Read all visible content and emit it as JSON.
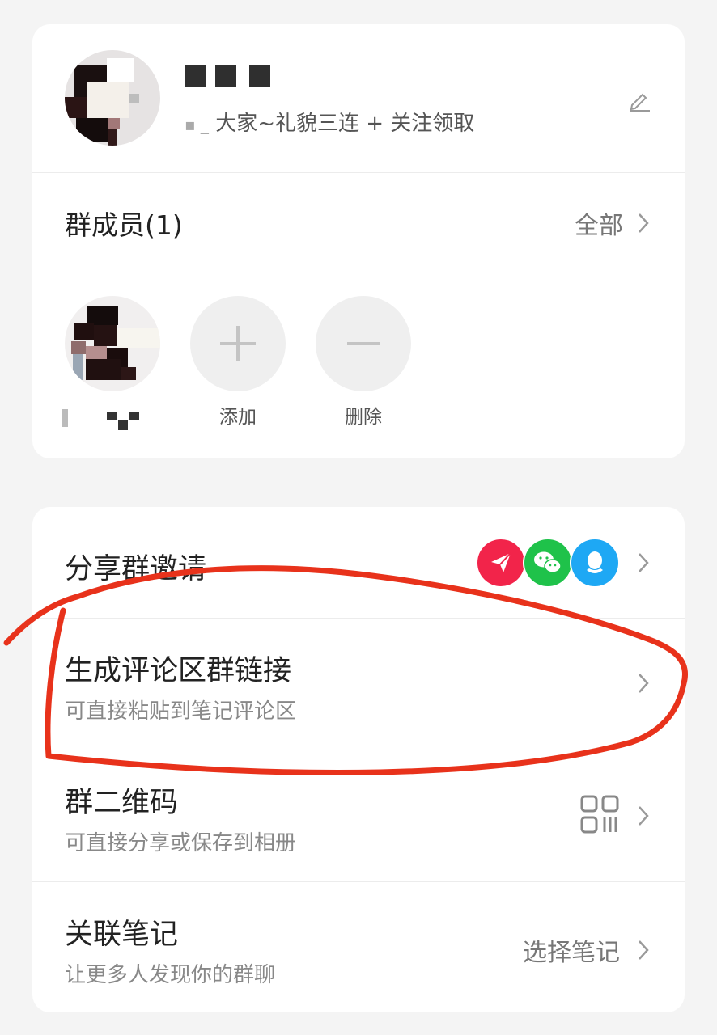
{
  "profile": {
    "description": "大家~礼貌三连 + 关注领取"
  },
  "members": {
    "title": "群成员(1)",
    "all_label": "全部",
    "add_label": "添加",
    "remove_label": "删除"
  },
  "list": {
    "share_invite": {
      "title": "分享群邀请"
    },
    "comment_link": {
      "title": "生成评论区群链接",
      "subtitle": "可直接粘贴到笔记评论区"
    },
    "qrcode": {
      "title": "群二维码",
      "subtitle": "可直接分享或保存到相册"
    },
    "linked_note": {
      "title": "关联笔记",
      "subtitle": "让更多人发现你的群聊",
      "action_label": "选择笔记"
    }
  },
  "icons": {
    "edit": "pencil-icon",
    "chevron": "chevron-right-icon",
    "add": "plus-icon",
    "remove": "minus-icon",
    "share_red": "paper-plane-icon",
    "share_green": "wechat-icon",
    "share_blue": "qq-icon",
    "qr": "qr-code-icon"
  },
  "colors": {
    "share_red": "#f2244a",
    "share_green": "#1fc24a",
    "share_blue": "#1ea8f4",
    "annotation": "#e8321b"
  }
}
